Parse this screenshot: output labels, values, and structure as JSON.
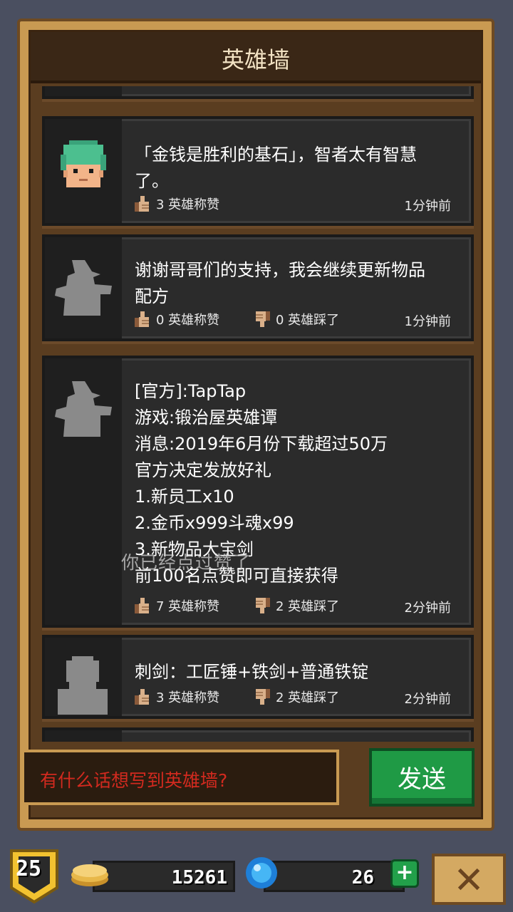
{
  "title": "英雄墙",
  "posts": [
    {
      "lines": [
        "「金钱是胜利的基石」，智者太有智慧",
        "了。"
      ],
      "likes": "3 英雄称赞",
      "dislikes": "",
      "time": "1分钟前",
      "avatar": "green-hair-hero"
    },
    {
      "lines": [
        "谢谢哥哥们的支持，我会继续更新物品",
        "配方"
      ],
      "likes": "0 英雄称赞",
      "dislikes": "0 英雄踩了",
      "time": "1分钟前",
      "avatar": "wizard-silhouette"
    },
    {
      "lines": [
        "[官方]:TapTap",
        "游戏:锻治屋英雄谭",
        "消息:2019年6月份下载超过50万",
        "官方决定发放好礼",
        "1.新员工x10",
        "2.金币x999斗魂x99",
        "3.新物品大宝剑",
        "前100名点赞即可直接获得"
      ],
      "likes": "7 英雄称赞",
      "dislikes": "2 英雄踩了",
      "time": "2分钟前",
      "avatar": "wizard-silhouette"
    },
    {
      "lines": [
        "刺剑：工匠锤+铁剑+普通铁锭"
      ],
      "likes": "3 英雄称赞",
      "dislikes": "2 英雄踩了",
      "time": "2分钟前",
      "avatar": "person-silhouette"
    }
  ],
  "toast": "你已经点过赞了",
  "input": {
    "placeholder": "有什么话想写到英雄墙?"
  },
  "send_label": "发送",
  "status": {
    "level": "25",
    "gold": "15261",
    "gems": "26",
    "plus": "+",
    "close": "✕"
  },
  "colors": {
    "frame": "#c99a52",
    "card": "#2b2b2b",
    "send": "#1f9a45",
    "placeholder": "#d22a1f"
  }
}
